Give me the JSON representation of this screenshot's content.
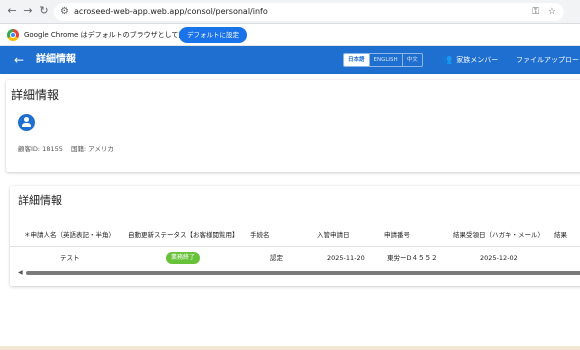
{
  "browser": {
    "url": "acroseed-web-app.web.app/consol/personal/info",
    "back_icon": "back-arrow-icon",
    "forward_icon": "forward-arrow-icon",
    "reload_icon": "reload-icon"
  },
  "infobar": {
    "message": "Google Chrome はデフォルトのブラウザとして設定されていません",
    "button_label": "デフォルトに設定"
  },
  "header": {
    "title": "詳細情報",
    "languages": [
      "日本語",
      "ENGLISH",
      "中文"
    ],
    "active_language": "日本語",
    "family_menu_label": "家族メンバー",
    "upload_menu_label": "ファイルアップロード",
    "accent_color": "#1f6fd1"
  },
  "detail_card": {
    "title": "詳細情報",
    "customer_id_label": "顧客ID: 18155",
    "country_label": "国籍: アメリカ"
  },
  "table_card": {
    "title": "詳細情報",
    "columns": [
      "＊申請人名（英語表記・半角）",
      "自動更新ステータス【お客様閲覧用】",
      "手続名",
      "入管申請日",
      "申請番号",
      "結果受領日（ハガキ・メール）",
      "結果"
    ],
    "rows": [
      {
        "applicant_name": "テスト",
        "status": "業務終了",
        "procedure": "認定",
        "application_date": "2025-11-20",
        "application_number": "東労ーD４５５２",
        "result_received_date": "2025-12-02",
        "result": ""
      }
    ],
    "status_color": "#67c23a"
  }
}
